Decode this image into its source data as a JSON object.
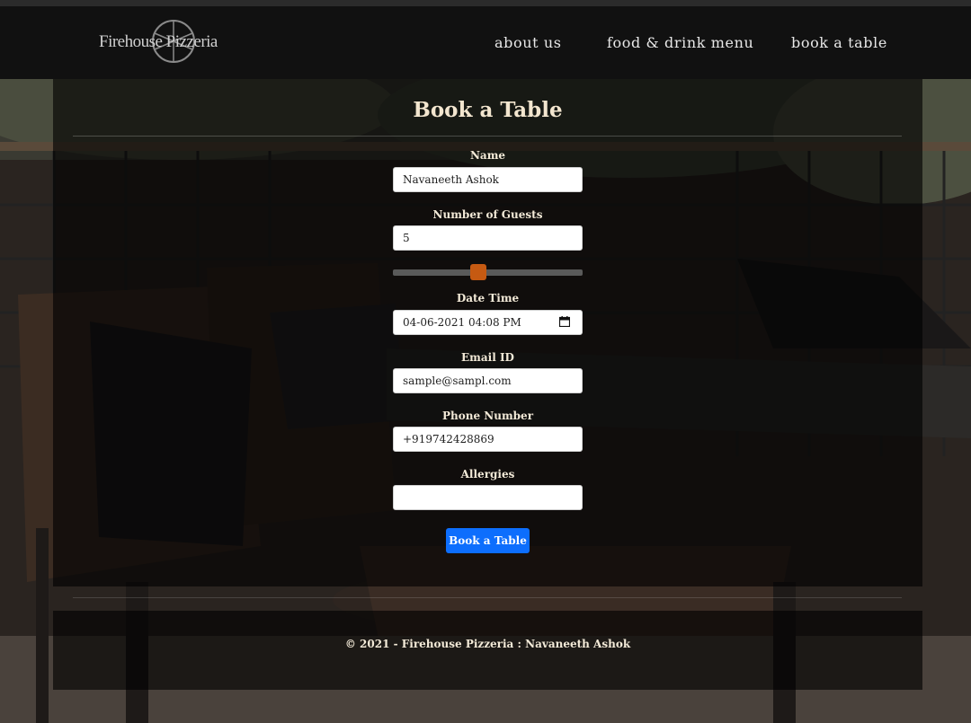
{
  "brand": {
    "name": "Firehouse Pizzeria",
    "logo_icon": "pizza-wheel-icon"
  },
  "nav": {
    "items": [
      {
        "label": "about us"
      },
      {
        "label": "food & drink menu"
      },
      {
        "label": "book a table"
      }
    ]
  },
  "form": {
    "title": "Book a Table",
    "name": {
      "label": "Name",
      "value": "Navaneeth Ashok"
    },
    "guests": {
      "label": "Number of Guests",
      "value": "5",
      "slider_fraction": 0.45
    },
    "datetime": {
      "label": "Date Time",
      "value": "04-06-2021 04:08 PM",
      "icon": "calendar-icon"
    },
    "email": {
      "label": "Email ID",
      "value": "sample@sampl.com"
    },
    "phone": {
      "label": "Phone Number",
      "value": "+919742428869"
    },
    "allergies": {
      "label": "Allergies",
      "value": ""
    },
    "submit_label": "Book a Table"
  },
  "footer": {
    "copyright": "© 2021 - Firehouse Pizzeria : Navaneeth Ashok"
  },
  "colors": {
    "accent": "#0d6efd",
    "slider_thumb": "#c65a12",
    "heading_text": "#f3e6cf"
  }
}
